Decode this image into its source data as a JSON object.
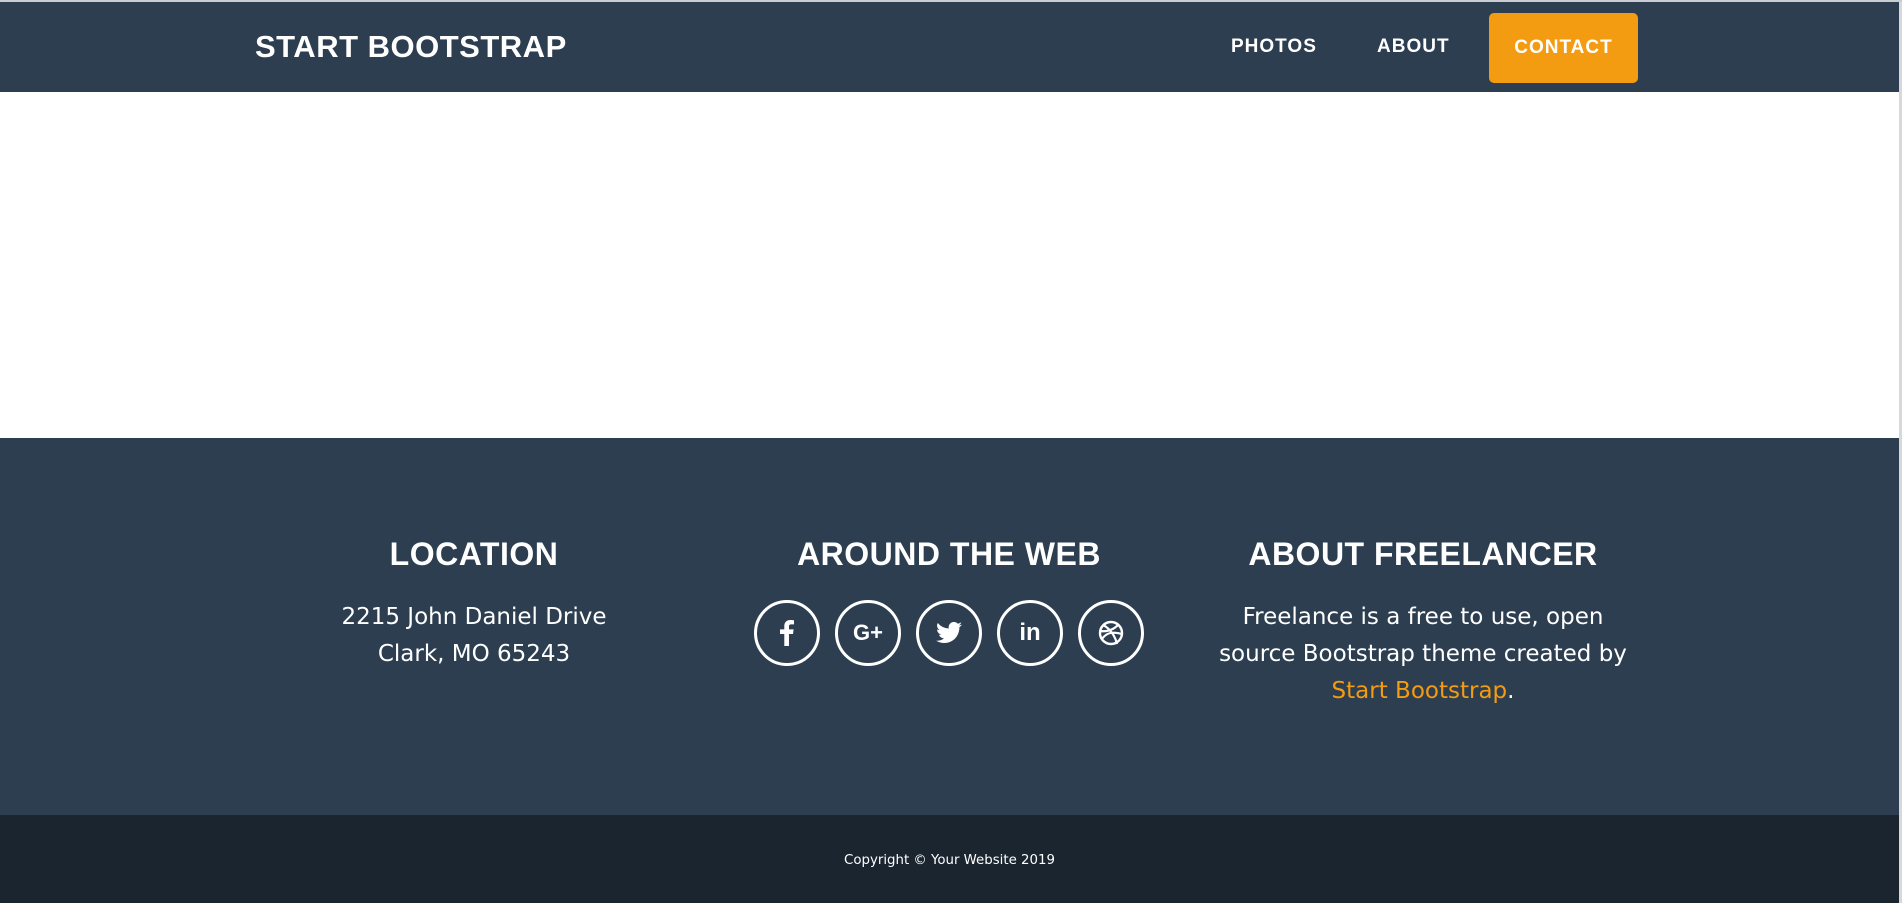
{
  "navbar": {
    "brand": "START BOOTSTRAP",
    "links": [
      {
        "label": "PHOTOS"
      },
      {
        "label": "ABOUT"
      },
      {
        "label": "CONTACT"
      }
    ],
    "accent": "#f39c12",
    "background": "#2c3e50"
  },
  "footer": {
    "location": {
      "heading": "LOCATION",
      "line1": "2215 John Daniel Drive",
      "line2": "Clark, MO 65243"
    },
    "web": {
      "heading": "AROUND THE WEB",
      "icons": [
        "facebook-icon",
        "google-plus-icon",
        "twitter-icon",
        "linkedin-icon",
        "dribbble-icon"
      ]
    },
    "about": {
      "heading": "ABOUT FREELANCER",
      "text_before": "Freelance is a free to use, open source Bootstrap theme created by ",
      "link": "Start Bootstrap",
      "text_after": "."
    },
    "copyright": "Copyright © Your Website 2019",
    "background": "#2c3e50",
    "copyright_background": "#1a252f"
  }
}
